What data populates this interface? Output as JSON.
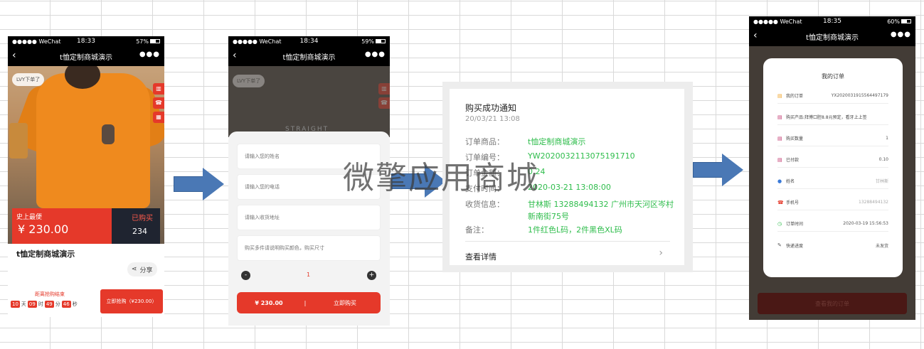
{
  "phone1": {
    "status": {
      "carrier": "●●●●● WeChat",
      "time": "18:33",
      "battery": "57%",
      "battery_level": 0.57
    },
    "nav_title": "t恤定制商城演示",
    "watermark_badge": "LVY下单了",
    "price_label": "史上最便",
    "price": "¥ 230.00",
    "sold_label": "已购买",
    "sold_count": "234",
    "product_title": "t恤定制商城演示",
    "share_label": "分享",
    "countdown_label": "距离抢购结束",
    "countdown": {
      "days": "10",
      "days_unit": "天",
      "hours": "09",
      "hours_unit": "时",
      "minutes": "49",
      "minutes_unit": "分",
      "seconds": "46",
      "seconds_unit": "秒"
    },
    "buy_button": "立即抢购（¥230.00）"
  },
  "phone2": {
    "status": {
      "carrier": "●●●●● WeChat",
      "time": "18:34",
      "battery": "59%",
      "battery_level": 0.59
    },
    "nav_title": "t恤定制商城演示",
    "watermark_badge": "LVY下单了",
    "banner_text": "STRAIGHT",
    "fields": [
      {
        "placeholder": "请输入您的姓名"
      },
      {
        "placeholder": "请输入您的电话"
      },
      {
        "placeholder": "请输入收货地址"
      },
      {
        "placeholder": "购买多件请说明购买颜色，购买尺寸"
      }
    ],
    "quantity": "1",
    "minus": "-",
    "plus": "+",
    "total": "¥ 230.00",
    "separator": "|",
    "buy_now": "立即购买"
  },
  "notice": {
    "title": "购买成功通知",
    "date": "20/03/21 13:08",
    "rows": [
      {
        "key": "订单商品：",
        "value": "t恤定制商城演示"
      },
      {
        "key": "订单编号：",
        "value": "YW20200321130751917​10"
      },
      {
        "key": "订单金额：",
        "value": "0.24"
      },
      {
        "key": "支付时间：",
        "value": "2020-03-21 13:08:00"
      },
      {
        "key": "收货信息：",
        "value": "甘林斯 13288494132 广州市天河区岑村新南街75号"
      },
      {
        "key": "备注：",
        "value": "1件红色L码，2件黑色XL码"
      }
    ],
    "detail": "查看详情"
  },
  "phone4": {
    "status": {
      "carrier": "●●●●● WeChat",
      "time": "18:35",
      "battery": "60%",
      "battery_level": 0.6
    },
    "nav_title": "t恤定制商城演示",
    "card_title": "我的订单",
    "rows": [
      {
        "icon": "▤",
        "key": "我的订单",
        "value": "YX2020031915564497179"
      },
      {
        "icon": "▤",
        "key": "购买产品:拜博口腔8.8元预定，看牙上上签",
        "value": ""
      },
      {
        "icon": "▤",
        "key": "购买数量",
        "value": "1"
      },
      {
        "icon": "▤",
        "key": "已付款",
        "value": "0.10"
      },
      {
        "icon": "●",
        "key": "姓名",
        "value": "甘林斯"
      },
      {
        "icon": "☎",
        "key": "手机号",
        "value": "13288494132"
      },
      {
        "icon": "◷",
        "key": "订单时间",
        "value": "2020-03-19 15:56:53"
      },
      {
        "icon": "✎",
        "key": "快递进度",
        "value": "未发货"
      }
    ],
    "bottom_button": "查看我的订单"
  },
  "watermark": "微擎应用商城",
  "colors": {
    "accent_red": "#e5392a",
    "green_value": "#2fbd4c",
    "arrow_blue": "#4a78b5"
  }
}
